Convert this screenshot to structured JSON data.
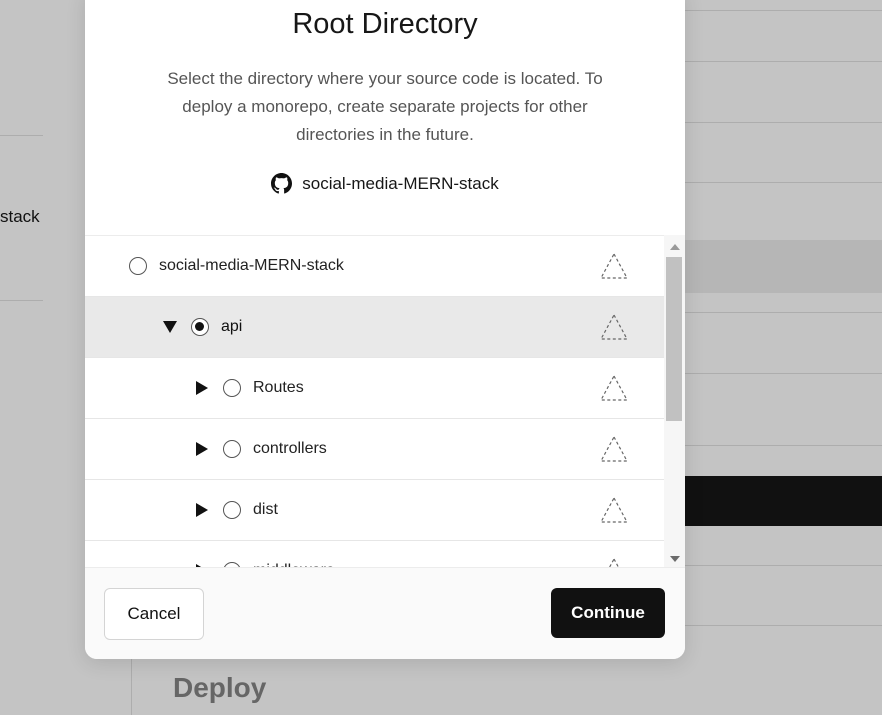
{
  "background": {
    "left_text": "stack",
    "section_title": "Deploy"
  },
  "modal": {
    "title": "Root Directory",
    "description": "Select the directory where your source code is located. To deploy a monorepo, create separate projects for other directories in the future.",
    "repo": {
      "icon": "github-icon",
      "name": "social-media-MERN-stack"
    },
    "tree": [
      {
        "label": "social-media-MERN-stack",
        "selected": false,
        "expander": "none",
        "framework_icon": "triangle-dashed-icon"
      },
      {
        "label": "api",
        "selected": true,
        "expander": "expanded",
        "framework_icon": "triangle-dashed-icon"
      },
      {
        "label": "Routes",
        "selected": false,
        "expander": "collapsed",
        "framework_icon": "triangle-dashed-icon"
      },
      {
        "label": "controllers",
        "selected": false,
        "expander": "collapsed",
        "framework_icon": "triangle-dashed-icon"
      },
      {
        "label": "dist",
        "selected": false,
        "expander": "collapsed",
        "framework_icon": "triangle-dashed-icon"
      },
      {
        "label": "middleware",
        "selected": false,
        "expander": "collapsed",
        "framework_icon": "triangle-dashed-icon"
      }
    ],
    "buttons": {
      "cancel": "Cancel",
      "continue": "Continue"
    }
  },
  "colors": {
    "primary_button": "#111111",
    "selected_row": "#e9e9e9",
    "overlay": "#c4c4c4"
  }
}
